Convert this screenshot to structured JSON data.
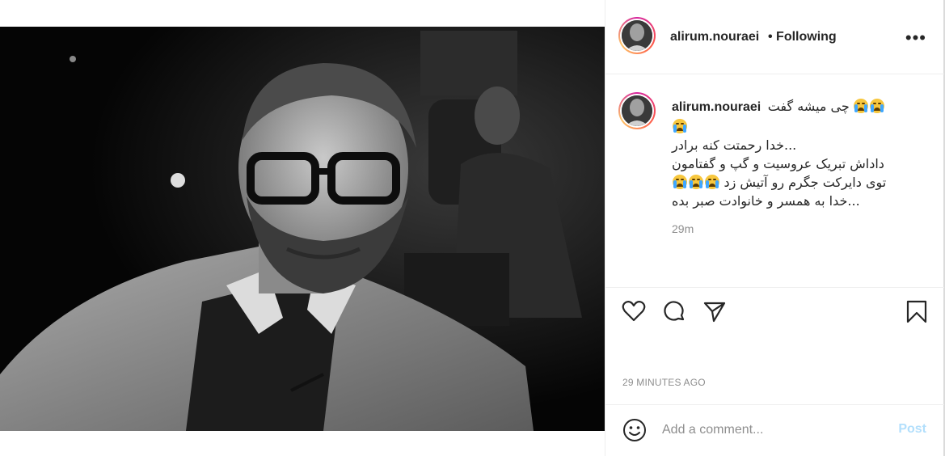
{
  "post": {
    "username": "alirum.nouraei",
    "following": "• Following",
    "more_icon": "more-horizontal-icon",
    "caption": {
      "username": "alirum.nouraei",
      "line1": "چی میشه گفت",
      "line2": "...خدا رحمتت کنه برادر",
      "line3": "داداش تبریک عروسیت و گپ و گفتامون",
      "line4": "توی دایرکت جگرم رو آتیش زد",
      "line5": "...خدا به همسر و خانوادت صبر بده",
      "emoji": "loudly-crying-face-icon",
      "relative_time": "29m"
    },
    "actions": [
      "heart-icon",
      "comment-icon",
      "share-icon",
      "bookmark-icon"
    ],
    "timestamp": "29 MINUTES AGO",
    "comment": {
      "placeholder": "Add a comment...",
      "post_label": "Post"
    }
  }
}
